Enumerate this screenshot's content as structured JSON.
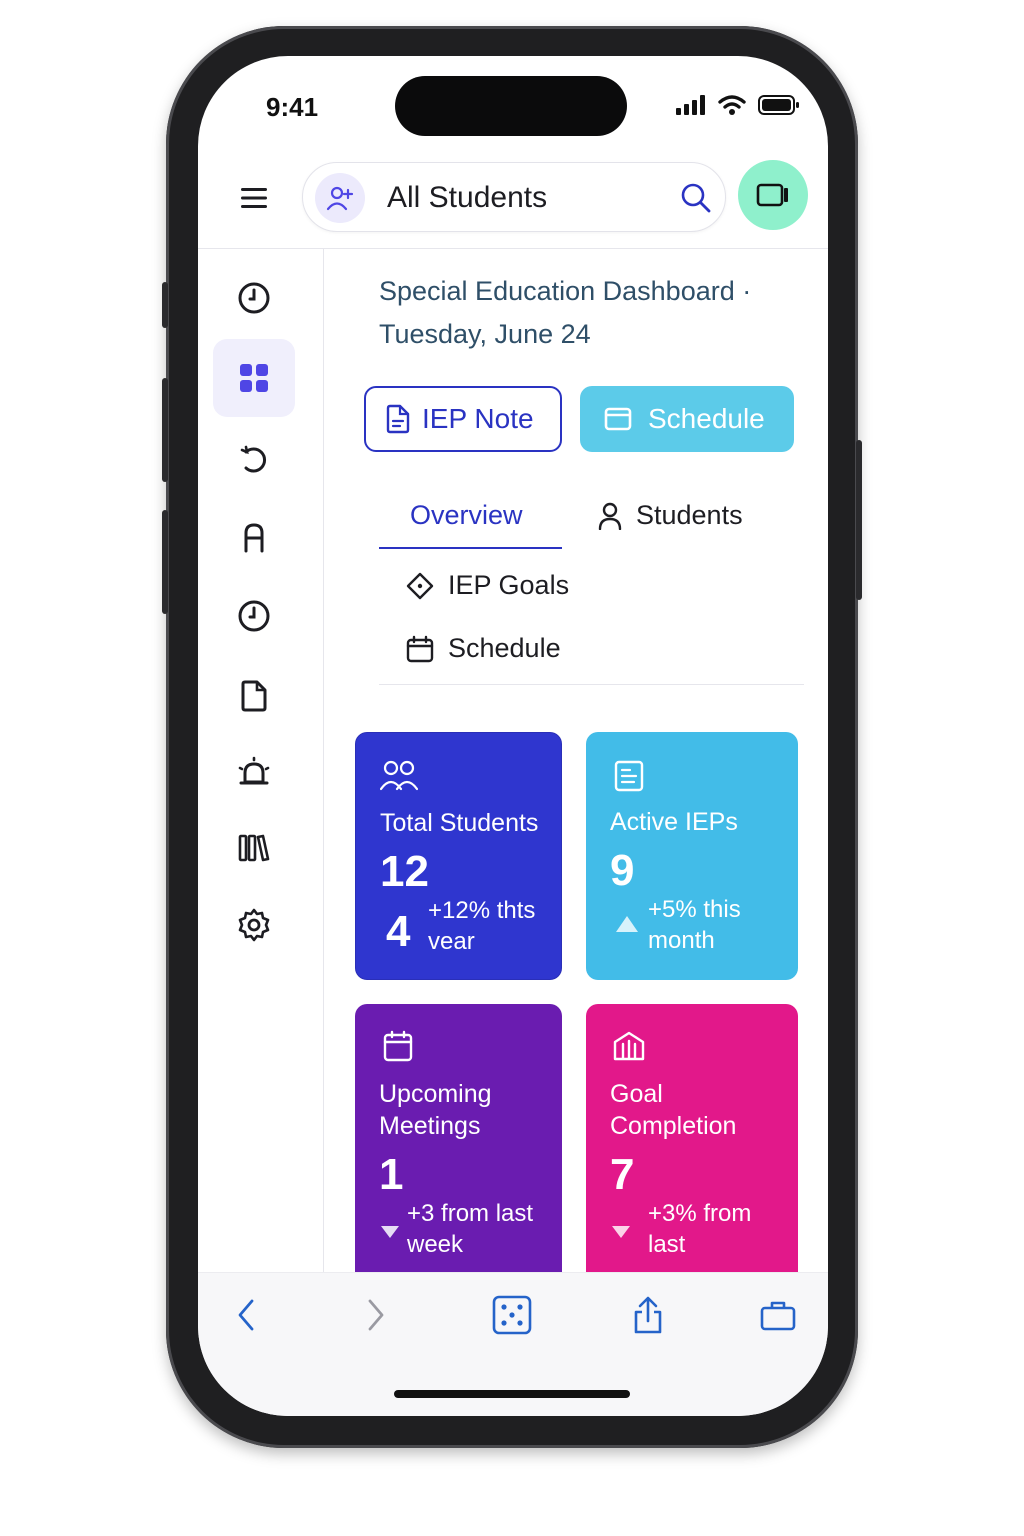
{
  "status_bar": {
    "time": "9:41"
  },
  "search": {
    "text": "All Students"
  },
  "header": {
    "title": "Special Education Dashboard · Tuesday, June 24"
  },
  "actions": {
    "iep_note": "IEP Note",
    "schedule": "Schedule"
  },
  "tabs": [
    {
      "label": "Overview",
      "active": true
    },
    {
      "label": "Students",
      "icon": "person-icon"
    },
    {
      "label": "IEP Goals",
      "icon": "diamond-icon"
    },
    {
      "label": "Schedule",
      "icon": "calendar-icon"
    }
  ],
  "sidebar": {
    "items": [
      {
        "icon": "clock-icon"
      },
      {
        "icon": "grid-icon",
        "active": true
      },
      {
        "icon": "refresh-icon"
      },
      {
        "icon": "letter-a-icon"
      },
      {
        "icon": "clock-icon"
      },
      {
        "icon": "document-icon"
      },
      {
        "icon": "bell-icon"
      },
      {
        "icon": "library-icon"
      },
      {
        "icon": "gear-icon"
      }
    ]
  },
  "cards": [
    {
      "label": "Total Students",
      "value": "12",
      "sub_value": "4",
      "delta": "+12% thts vear",
      "color": "#2f36cf",
      "icon": "people-icon"
    },
    {
      "label": "Active IEPs",
      "value": "9",
      "delta": "+5% this month",
      "color": "#42bce8",
      "icon": "document-icon"
    },
    {
      "label": "Upcoming Meetings",
      "value": "1",
      "delta": "+3 from last week",
      "color": "#6a1cb0",
      "icon": "calendar-icon"
    },
    {
      "label": "Goal Completion",
      "value": "7",
      "delta": "+3% from last",
      "color": "#e2188a",
      "icon": "bank-icon"
    }
  ],
  "colors": {
    "accent": "#2a33c2",
    "schedule_button": "#5ccbe9",
    "video_button": "#8ff0cc"
  }
}
